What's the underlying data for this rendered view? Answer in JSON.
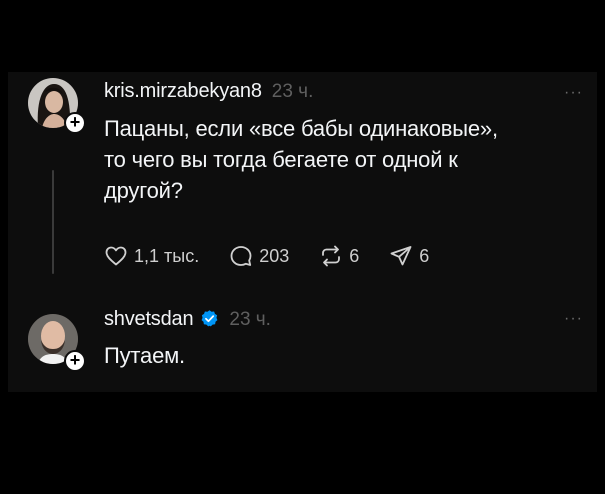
{
  "posts": [
    {
      "username": "kris.mirzabekyan8",
      "time": "23 ч.",
      "text_lines": [
        "Пацаны, если «все бабы одинаковые»,",
        "то чего вы тогда бегаете от одной к",
        "другой?"
      ],
      "likes": "1,1 тыс.",
      "comments": "203",
      "reposts": "6",
      "shares": "6"
    },
    {
      "username": "shvetsdan",
      "verified": true,
      "time": "23 ч.",
      "text_lines": [
        "Путаем."
      ]
    }
  ],
  "more_label": "···",
  "follow_plus": "+",
  "icons": [
    "heart-icon",
    "comment-icon",
    "repost-icon",
    "share-icon",
    "verified-badge-icon",
    "more-icon",
    "follow-plus-icon"
  ],
  "colors": {
    "background": "#0d0d0d",
    "text": "#f3f5f7",
    "muted": "#5f5f5f",
    "verified": "#0095f6"
  }
}
